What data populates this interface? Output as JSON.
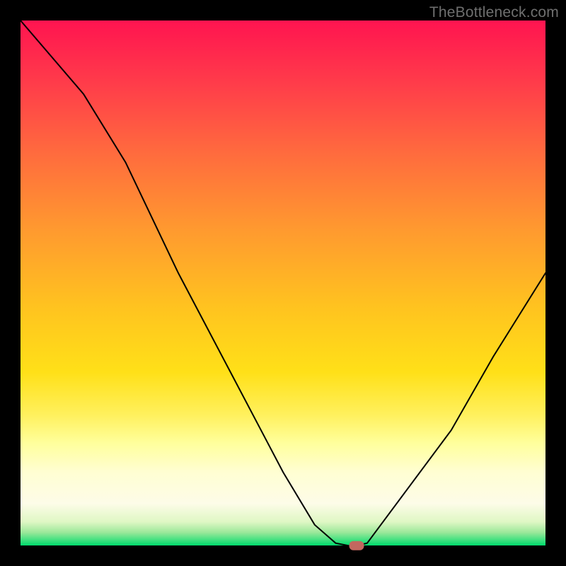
{
  "watermark": "TheBottleneck.com",
  "chart_data": {
    "type": "line",
    "title": "",
    "xlabel": "",
    "ylabel": "",
    "xlim": [
      0,
      100
    ],
    "ylim": [
      0,
      100
    ],
    "series": [
      {
        "name": "curve",
        "x": [
          0,
          12,
          20,
          30,
          40,
          50,
          56,
          60,
          62.5,
          64,
          66,
          82,
          90,
          100
        ],
        "values": [
          100,
          86,
          73,
          52,
          33,
          14,
          4,
          0.5,
          0,
          0,
          0.5,
          22,
          36,
          52
        ]
      }
    ],
    "marker": {
      "x": 64,
      "y": 0,
      "color": "#c3675f"
    },
    "gradient_stops": [
      {
        "pos": 0.0,
        "color": "#ff1450"
      },
      {
        "pos": 0.12,
        "color": "#ff3c4a"
      },
      {
        "pos": 0.25,
        "color": "#ff6a3e"
      },
      {
        "pos": 0.4,
        "color": "#ff9a2f"
      },
      {
        "pos": 0.55,
        "color": "#ffc41f"
      },
      {
        "pos": 0.67,
        "color": "#ffe018"
      },
      {
        "pos": 0.75,
        "color": "#fff05c"
      },
      {
        "pos": 0.805,
        "color": "#ffff9c"
      },
      {
        "pos": 0.86,
        "color": "#fffed2"
      },
      {
        "pos": 0.92,
        "color": "#fdfce8"
      },
      {
        "pos": 0.955,
        "color": "#dff7c4"
      },
      {
        "pos": 0.975,
        "color": "#9ce89a"
      },
      {
        "pos": 1.0,
        "color": "#00db6c"
      }
    ]
  }
}
